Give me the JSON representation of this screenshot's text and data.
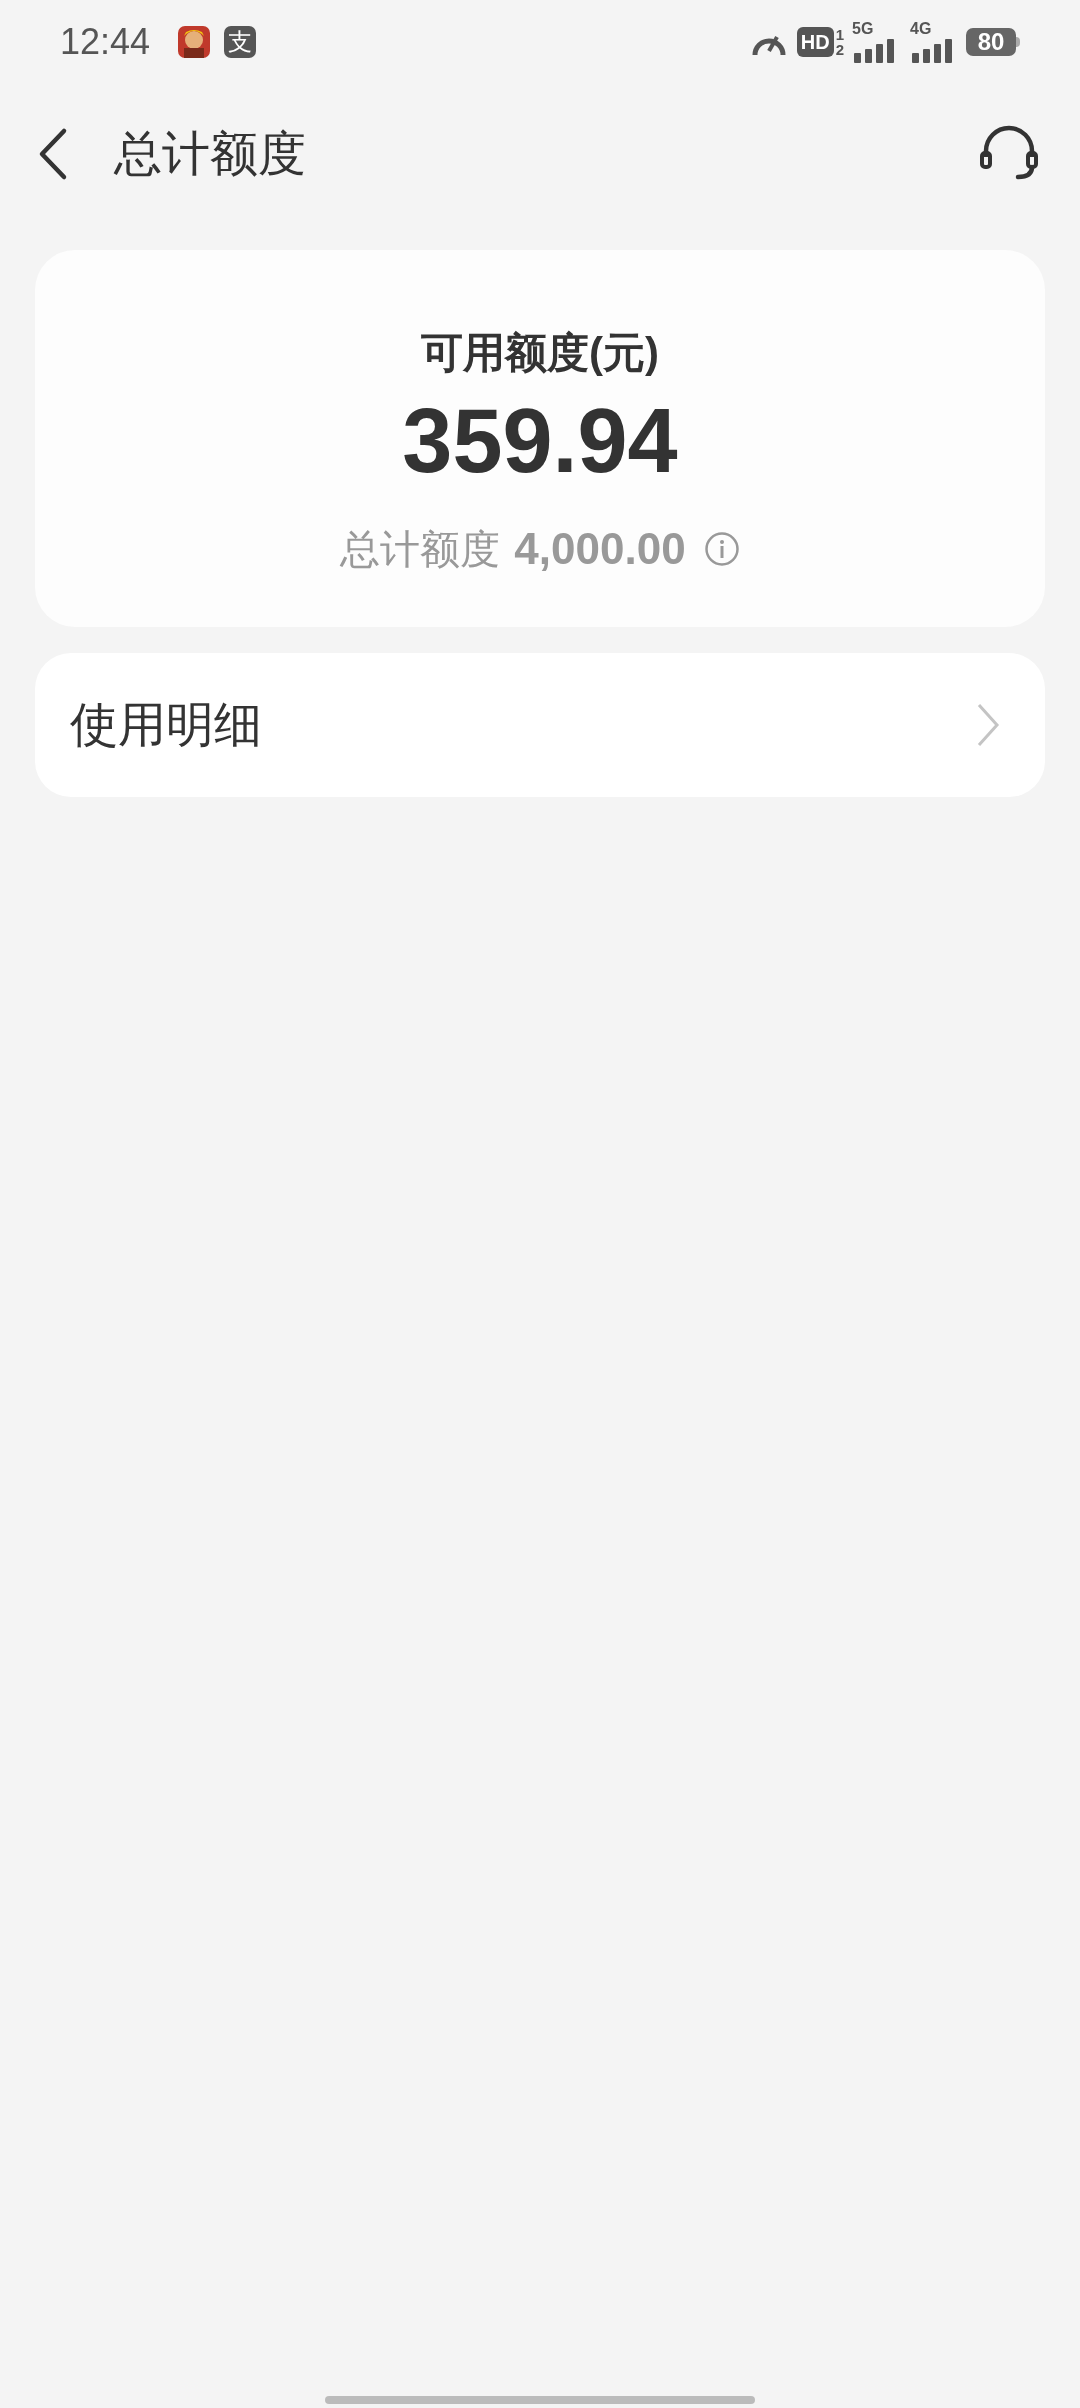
{
  "status_bar": {
    "time": "12:44",
    "alipay_badge": "支",
    "hd_label": "HD",
    "sim_1": "1",
    "sim_2": "2",
    "network_1": "5G",
    "network_2": "4G",
    "battery": "80"
  },
  "header": {
    "title": "总计额度"
  },
  "credit_card": {
    "label": "可用额度(元)",
    "available": "359.94",
    "total_label": "总计额度",
    "total_value": "4,000.00"
  },
  "menu": [
    {
      "label": "使用明细"
    }
  ]
}
